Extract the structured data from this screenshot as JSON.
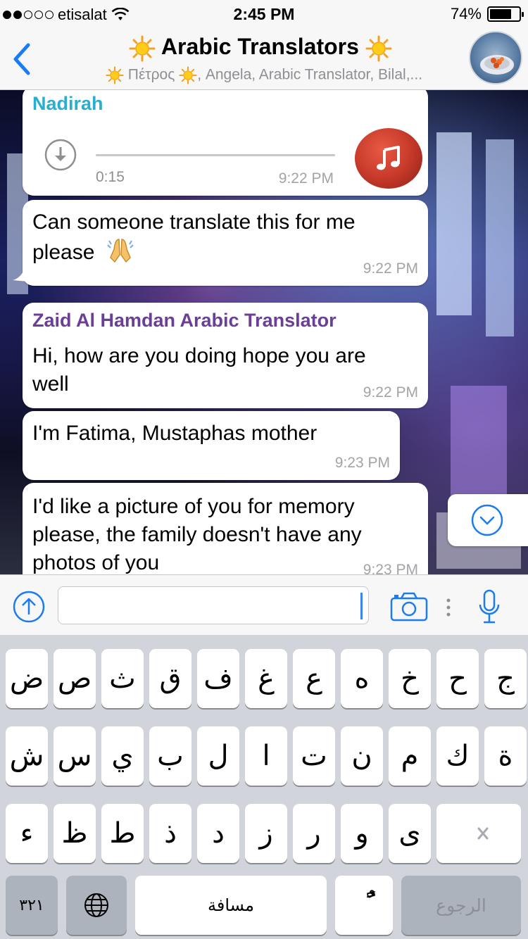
{
  "status_bar": {
    "carrier": "etisalat",
    "time": "2:45 PM",
    "battery": "74%",
    "battery_level": 0.74
  },
  "header": {
    "back_icon": "chevron-left-icon",
    "title": "Arabic Translators",
    "title_decoration": "sun-emoji",
    "subtitle": "Πέτρος",
    "subtitle_rest": ", Angela, Arabic Translator, Bilal,..."
  },
  "messages": [
    {
      "sender": "Nadirah",
      "sender_color": "#2aaecf",
      "type": "audio",
      "duration": "0:15",
      "time": "9:22 PM"
    },
    {
      "type": "text",
      "text_line1": "Can someone translate this for me",
      "text_line2": "please",
      "emoji": "folded-hands-emoji",
      "time": "9:22 PM"
    },
    {
      "sender": "Zaid Al Hamdan Arabic Translator",
      "sender_color": "#6b3f96",
      "type": "text",
      "text_line1": "Hi, how are you doing hope you are",
      "text_line2": "well",
      "time": "9:22 PM"
    },
    {
      "type": "text",
      "text_line1": "I'm Fatima, Mustaphas mother",
      "time": "9:23 PM"
    },
    {
      "type": "text",
      "text_line1": "I'd like a picture of you for memory",
      "text_line2": "please, the family doesn't have any",
      "text_line3": "photos of you",
      "time": "9:23 PM"
    }
  ],
  "input_bar": {
    "message_value": "",
    "accent_color": "#1a7cf0"
  },
  "keyboard": {
    "row1": [
      "ج",
      "ح",
      "خ",
      "ه",
      "ع",
      "غ",
      "ف",
      "ق",
      "ث",
      "ص",
      "ض"
    ],
    "row2": [
      "ة",
      "ك",
      "م",
      "ن",
      "ت",
      "ا",
      "ل",
      "ب",
      "ي",
      "س",
      "ش"
    ],
    "row3": [
      "ى",
      "و",
      "ر",
      "ز",
      "د",
      "ذ",
      "ط",
      "ظ",
      "ء"
    ],
    "diacritic_key": "ًٌ",
    "nums_key": "٣٢١",
    "space_key": "مسافة",
    "return_key": "الرجوع"
  }
}
